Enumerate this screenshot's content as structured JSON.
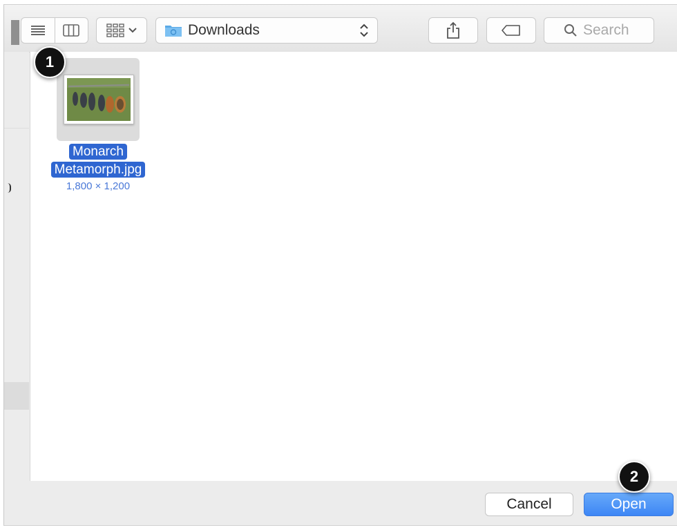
{
  "toolbar": {
    "view_icons": [
      "list-view-icon",
      "column-view-icon",
      "icon-grid-view-icon"
    ],
    "location": "Downloads",
    "search_placeholder": "Search"
  },
  "file": {
    "name_line1": "Monarch",
    "name_line2": "Metamorph.jpg",
    "dimensions": "1,800 × 1,200"
  },
  "buttons": {
    "cancel": "Cancel",
    "open": "Open"
  },
  "callouts": [
    "1",
    "2"
  ],
  "colors": {
    "selection": "#2f66d1",
    "primary_button": "#3d86f5",
    "callout": "#111111"
  }
}
